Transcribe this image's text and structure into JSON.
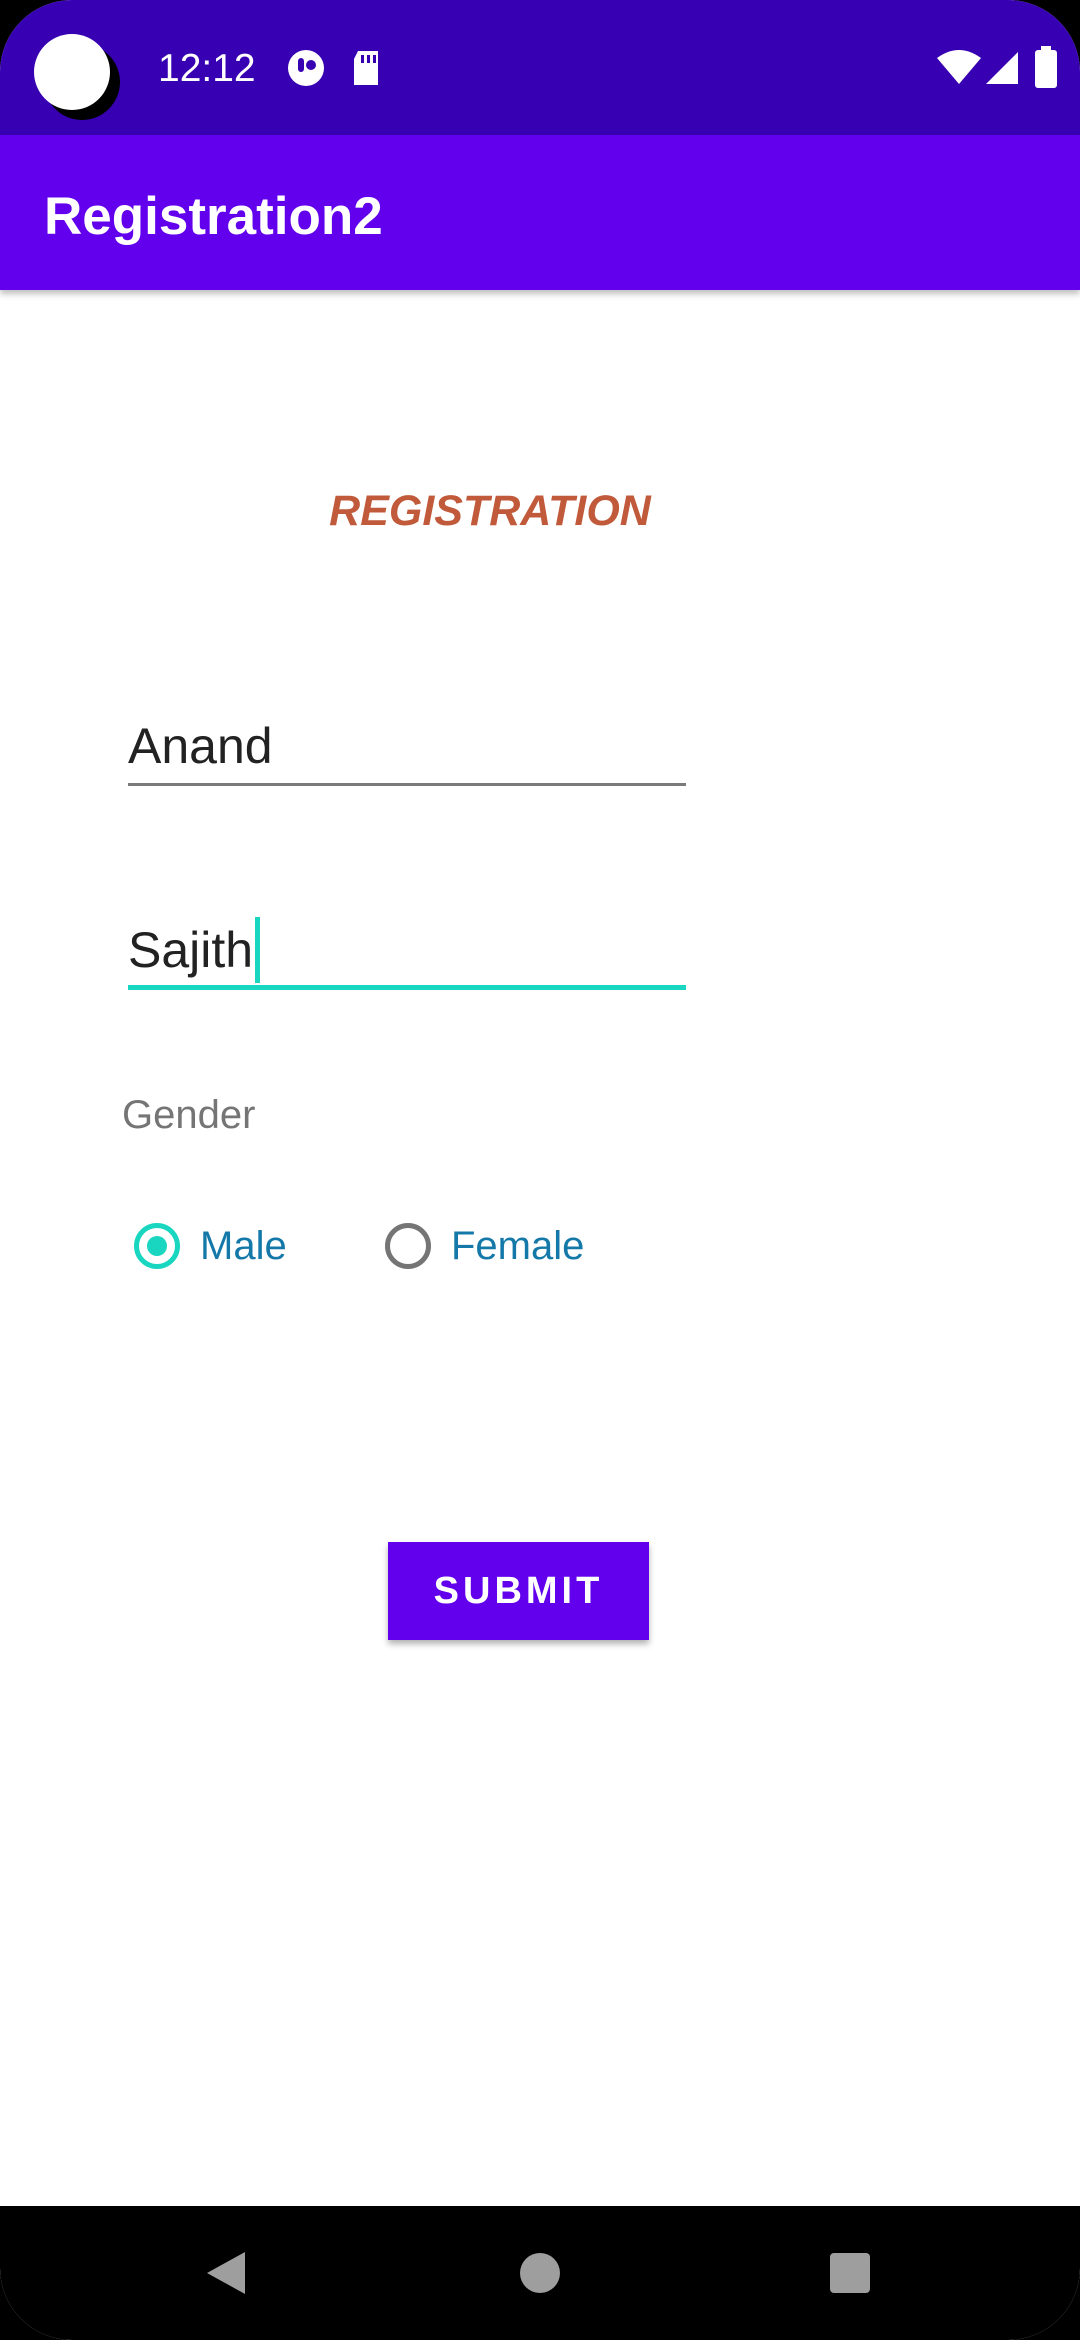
{
  "status_bar": {
    "time": "12:12",
    "left_icons": [
      "app-notification-icon",
      "sd-card-icon"
    ],
    "right_icons": [
      "wifi-icon",
      "cellular-signal-icon",
      "battery-icon"
    ]
  },
  "app_bar": {
    "title": "Registration2",
    "color": "#6200ee"
  },
  "form": {
    "heading": "REGISTRATION",
    "first_name_value": "Anand",
    "last_name_value": "Sajith",
    "gender_label": "Gender",
    "gender_options": [
      {
        "label": "Male",
        "checked": true
      },
      {
        "label": "Female",
        "checked": false
      }
    ],
    "submit_label": "SUBMIT"
  },
  "nav_bar": {
    "buttons": [
      "back-icon",
      "home-icon",
      "recents-icon"
    ]
  },
  "colors": {
    "status_bar": "#3700b3",
    "primary": "#6200ee",
    "accent": "#18d6c0",
    "heading": "#c05a3a",
    "radio_label": "#1478a8"
  }
}
